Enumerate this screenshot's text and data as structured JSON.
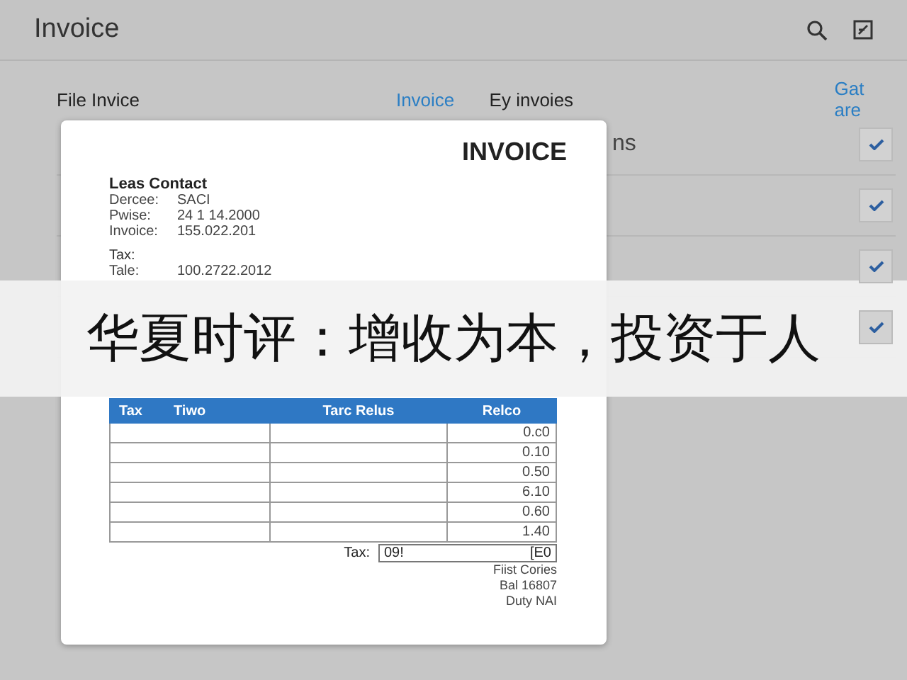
{
  "app_bar": {
    "title": "Invoice"
  },
  "list": {
    "heading": "File Invice",
    "link_left": "Invoice",
    "heading_right": "Ey invoies",
    "link_right": "Gat are",
    "row_fragment": "ns",
    "rows": [
      {
        "checked": true
      },
      {
        "checked": true
      },
      {
        "checked": true
      },
      {
        "checked": true
      }
    ]
  },
  "dialog": {
    "title": "INVOICE",
    "contact_heading": "Leas Contact",
    "fields": [
      {
        "label": "Dercee:",
        "value": "SACI"
      },
      {
        "label": "Pwise:",
        "value": "24 1 14.2000"
      },
      {
        "label": "Invoice:",
        "value": "155.022.201"
      }
    ],
    "tax_label": "Tax:",
    "tale": {
      "label": "Tale:",
      "value": "100.2722.2012"
    },
    "table": {
      "columns": [
        "Tax",
        "Tiwo",
        "Tarc Relus",
        "Relco"
      ],
      "rows": [
        "0.c0",
        "0.10",
        "0.50",
        "6.10",
        "0.60",
        "1.40"
      ]
    },
    "total": {
      "label": "Tax:",
      "value": "09!",
      "extra": "[E0"
    },
    "footer": [
      "Fiist Cories",
      "Bal 16807",
      "Duty NAI"
    ]
  },
  "headline": "华夏时评：增收为本，投资于人"
}
